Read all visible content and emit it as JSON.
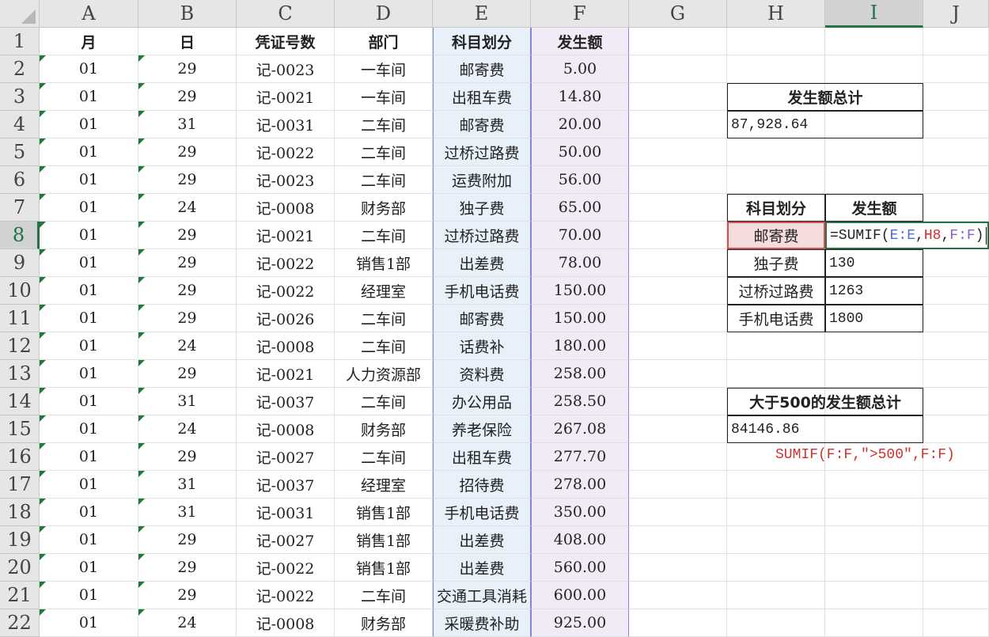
{
  "columns": [
    "A",
    "B",
    "C",
    "D",
    "E",
    "F",
    "G",
    "H",
    "I",
    "J"
  ],
  "rows": [
    "1",
    "2",
    "3",
    "4",
    "5",
    "6",
    "7",
    "8",
    "9",
    "10",
    "11",
    "12",
    "13",
    "14",
    "15",
    "16",
    "17",
    "18",
    "19",
    "20",
    "21",
    "22"
  ],
  "headers": {
    "a": "月",
    "b": "日",
    "c": "凭证号数",
    "d": "部门",
    "e": "科目划分",
    "f": "发生额"
  },
  "data": [
    {
      "a": "01",
      "b": "29",
      "c": "记-0023",
      "d": "一车间",
      "e": "邮寄费",
      "f": "5.00"
    },
    {
      "a": "01",
      "b": "29",
      "c": "记-0021",
      "d": "一车间",
      "e": "出租车费",
      "f": "14.80"
    },
    {
      "a": "01",
      "b": "31",
      "c": "记-0031",
      "d": "二车间",
      "e": "邮寄费",
      "f": "20.00"
    },
    {
      "a": "01",
      "b": "29",
      "c": "记-0022",
      "d": "二车间",
      "e": "过桥过路费",
      "f": "50.00"
    },
    {
      "a": "01",
      "b": "29",
      "c": "记-0023",
      "d": "二车间",
      "e": "运费附加",
      "f": "56.00"
    },
    {
      "a": "01",
      "b": "24",
      "c": "记-0008",
      "d": "财务部",
      "e": "独子费",
      "f": "65.00"
    },
    {
      "a": "01",
      "b": "29",
      "c": "记-0021",
      "d": "二车间",
      "e": "过桥过路费",
      "f": "70.00"
    },
    {
      "a": "01",
      "b": "29",
      "c": "记-0022",
      "d": "销售1部",
      "e": "出差费",
      "f": "78.00"
    },
    {
      "a": "01",
      "b": "29",
      "c": "记-0022",
      "d": "经理室",
      "e": "手机电话费",
      "f": "150.00"
    },
    {
      "a": "01",
      "b": "29",
      "c": "记-0026",
      "d": "二车间",
      "e": "邮寄费",
      "f": "150.00"
    },
    {
      "a": "01",
      "b": "24",
      "c": "记-0008",
      "d": "二车间",
      "e": "话费补",
      "f": "180.00"
    },
    {
      "a": "01",
      "b": "29",
      "c": "记-0021",
      "d": "人力资源部",
      "e": "资料费",
      "f": "258.00"
    },
    {
      "a": "01",
      "b": "31",
      "c": "记-0037",
      "d": "二车间",
      "e": "办公用品",
      "f": "258.50"
    },
    {
      "a": "01",
      "b": "24",
      "c": "记-0008",
      "d": "财务部",
      "e": "养老保险",
      "f": "267.08"
    },
    {
      "a": "01",
      "b": "29",
      "c": "记-0027",
      "d": "二车间",
      "e": "出租车费",
      "f": "277.70"
    },
    {
      "a": "01",
      "b": "31",
      "c": "记-0037",
      "d": "经理室",
      "e": "招待费",
      "f": "278.00"
    },
    {
      "a": "01",
      "b": "31",
      "c": "记-0031",
      "d": "销售1部",
      "e": "手机电话费",
      "f": "350.00"
    },
    {
      "a": "01",
      "b": "29",
      "c": "记-0027",
      "d": "销售1部",
      "e": "出差费",
      "f": "408.00"
    },
    {
      "a": "01",
      "b": "29",
      "c": "记-0022",
      "d": "销售1部",
      "e": "出差费",
      "f": "560.00"
    },
    {
      "a": "01",
      "b": "29",
      "c": "记-0022",
      "d": "二车间",
      "e": "交通工具消耗",
      "f": "600.00"
    },
    {
      "a": "01",
      "b": "24",
      "c": "记-0008",
      "d": "财务部",
      "e": "采暖费补助",
      "f": "925.00"
    }
  ],
  "summary": {
    "total_label": "发生额总计",
    "total_value": "87,928.64",
    "sub_header_subject": "科目划分",
    "sub_header_amount": "发生额",
    "sub_rows": [
      {
        "subject": "邮寄费",
        "amount": ""
      },
      {
        "subject": "独子费",
        "amount": "130"
      },
      {
        "subject": "过桥过路费",
        "amount": "1263"
      },
      {
        "subject": "手机电话费",
        "amount": "1800"
      }
    ],
    "formula_parts": {
      "p1": "=SUMIF(",
      "p2": "E:E",
      "p3": ",",
      "p4": "H8",
      "p5": ",",
      "p6": "F:F",
      "p7": ")"
    },
    "over500_label": "大于500的发生额总计",
    "over500_value": "84146.86",
    "over500_formula": "SUMIF(F:F,\">500\",F:F)"
  }
}
